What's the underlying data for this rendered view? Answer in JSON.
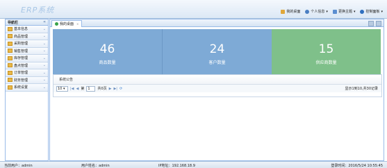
{
  "app": {
    "logo": "ERP系统"
  },
  "topmenu": {
    "home": "我的桌面",
    "profile": "个人信息",
    "theme": "更换主题",
    "control": "控制面板"
  },
  "sidebar": {
    "title": "导航栏",
    "items": [
      {
        "label": "基本信息"
      },
      {
        "label": "商品管理"
      },
      {
        "label": "采购管理"
      },
      {
        "label": "销售管理"
      },
      {
        "label": "库存管理"
      },
      {
        "label": "盘点管理"
      },
      {
        "label": "订单管理"
      },
      {
        "label": "财务管理"
      },
      {
        "label": "系统设置"
      }
    ]
  },
  "tab": {
    "label": "我的桌面"
  },
  "stats": [
    {
      "value": "46",
      "label": "商品数量",
      "color": "#7eaad6"
    },
    {
      "value": "24",
      "label": "客户数量",
      "color": "#7eaad6"
    },
    {
      "value": "15",
      "label": "供应商数量",
      "color": "#7fc08a"
    }
  ],
  "notice": {
    "title": "系统公告",
    "page_size": "10",
    "page_prefix": "第",
    "page_value": "1",
    "page_suffix": "共0页",
    "info": "显示1到10,共30记录"
  },
  "status": {
    "current_user": "当前用户：admin",
    "user_name": "用户姓名：admin",
    "ip": "IP地址：192.168.18.9",
    "login_time": "登录时间：2016/5/24 10:55:45"
  }
}
